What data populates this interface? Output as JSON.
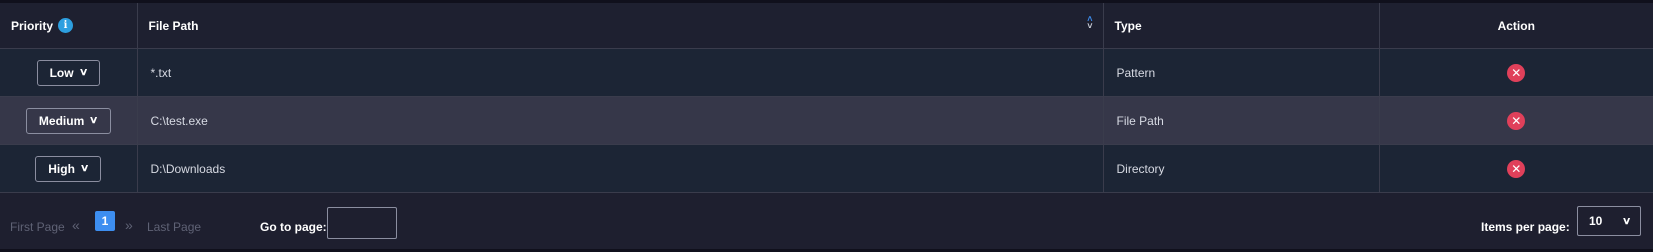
{
  "table": {
    "headers": {
      "priority": "Priority",
      "file_path": "File Path",
      "type": "Type",
      "action": "Action"
    },
    "icons": {
      "info": "info-icon",
      "sort": "sort-icon",
      "delete": "delete-icon"
    },
    "rows": [
      {
        "priority": "Low",
        "file_path": "*.txt",
        "type": "Pattern"
      },
      {
        "priority": "Medium",
        "file_path": "C:\\test.exe",
        "type": "File Path"
      },
      {
        "priority": "High",
        "file_path": "D:\\Downloads",
        "type": "Directory"
      }
    ]
  },
  "pagination": {
    "first_page": "First Page",
    "last_page": "Last Page",
    "current_page": "1",
    "go_to_page_label": "Go to page:",
    "go_to_page_value": "",
    "items_per_page_label": "Items per page:",
    "items_per_page_value": "10"
  },
  "colors": {
    "accent": "#3d8ef0",
    "delete": "#e0405a",
    "info": "#2d9fe0"
  }
}
